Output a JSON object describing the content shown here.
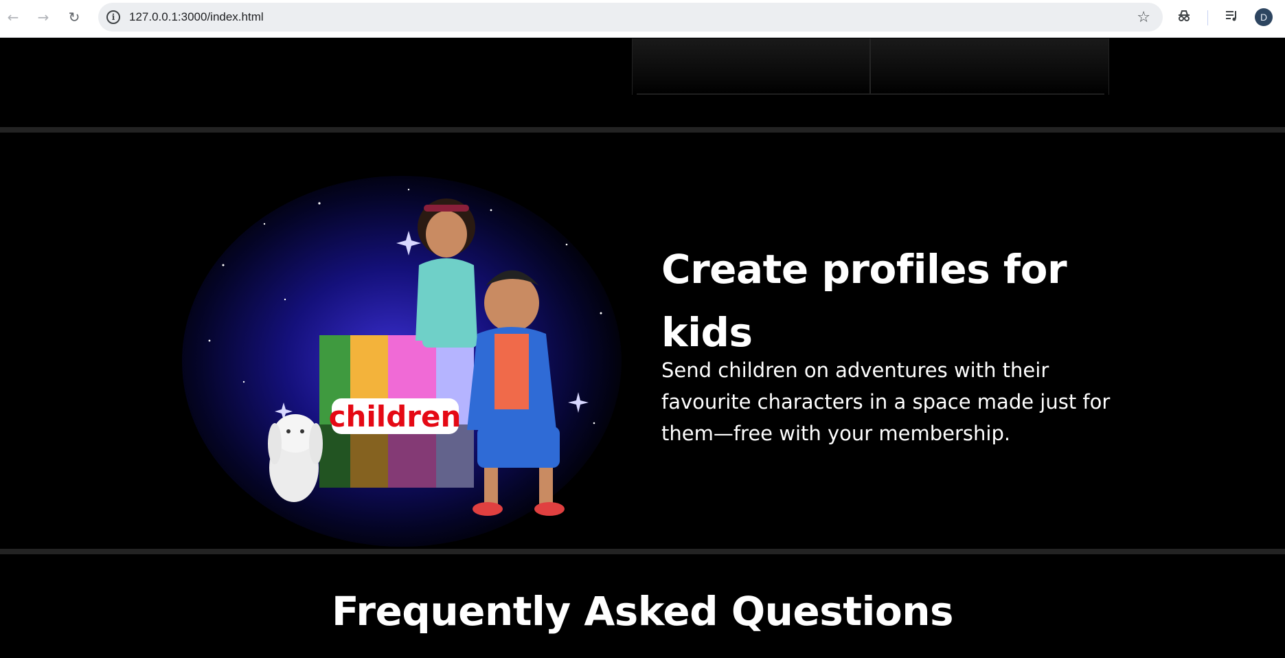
{
  "browser": {
    "url": "127.0.0.1:3000/index.html",
    "profile_initial": "D",
    "icons": {
      "back": "arrow-left-icon",
      "forward": "arrow-right-icon",
      "reload": "reload-icon",
      "site_info": "info-icon",
      "bookmark": "star-icon",
      "incognito": "incognito-icon",
      "media": "media-queue-icon"
    }
  },
  "kids_section": {
    "title": "Create profiles for kids",
    "description": "Send children on adventures with their favourite characters in a space made just for them—free with your membership.",
    "image_label": "children"
  },
  "faq": {
    "title": "Frequently Asked Questions"
  },
  "colors": {
    "page_background": "#000000",
    "divider": "#232323",
    "text": "#ffffff",
    "logo_red": "#e50914"
  }
}
